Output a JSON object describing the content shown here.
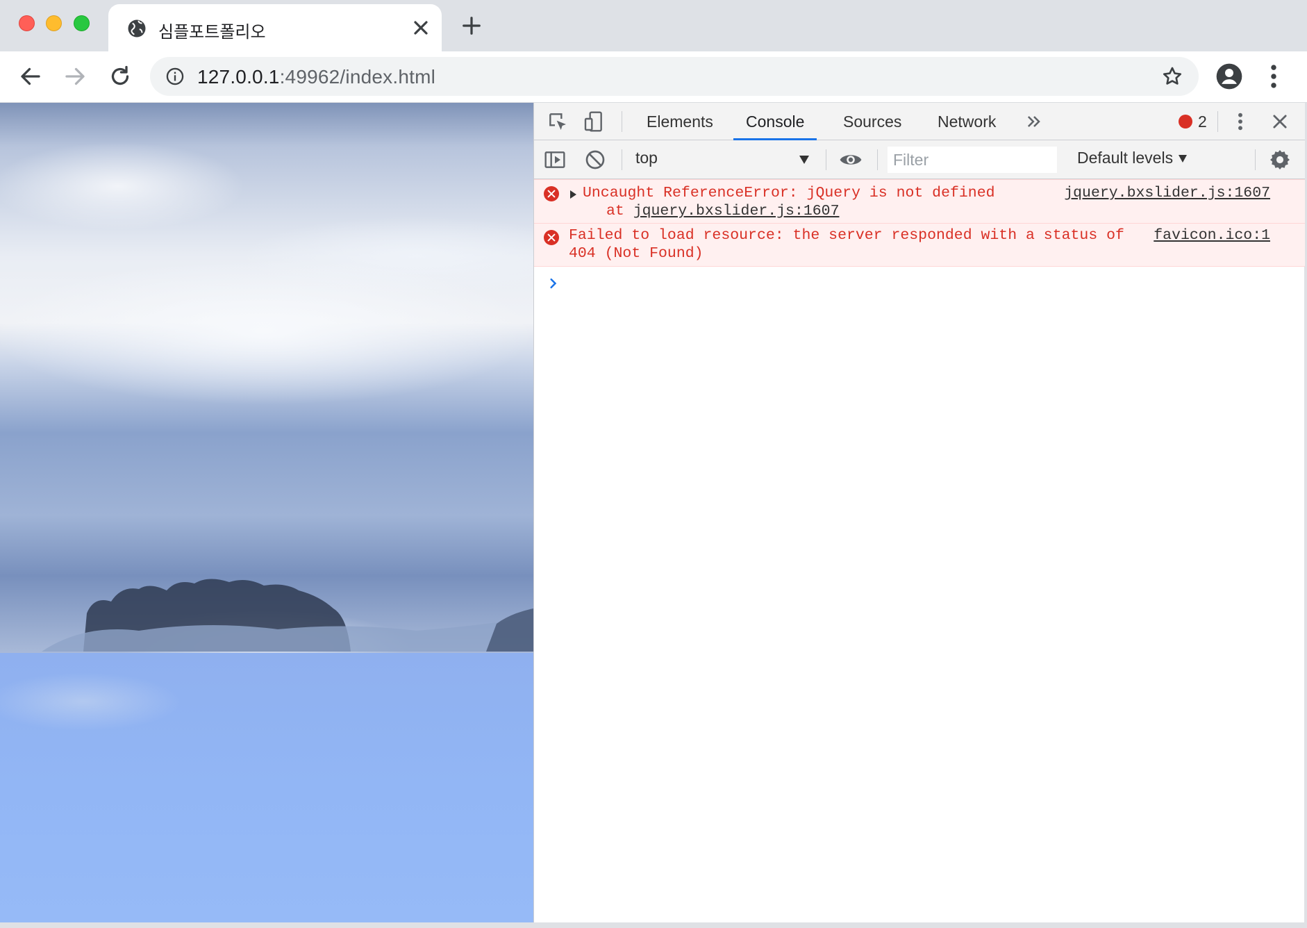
{
  "browser": {
    "tab_title": "심플포트폴리오",
    "url_host": "127.0.0.1",
    "url_rest": ":49962/index.html"
  },
  "devtools": {
    "tabs": [
      "Elements",
      "Console",
      "Sources",
      "Network"
    ],
    "active_tab": "Console",
    "error_count": "2",
    "context": "top",
    "filter_placeholder": "Filter",
    "levels_label": "Default levels",
    "messages": [
      {
        "line1": "Uncaught ReferenceError: jQuery is not defined",
        "line2_prefix": "at ",
        "line2_link": "jquery.bxslider.js:1607",
        "source": "jquery.bxslider.js:1607"
      },
      {
        "line1": "Failed to load resource: the server responded with a status of",
        "line2": "404 (Not Found)",
        "source": "favicon.ico:1"
      }
    ]
  },
  "colors": {
    "error": "#d93025",
    "accent": "#1a73e8"
  }
}
